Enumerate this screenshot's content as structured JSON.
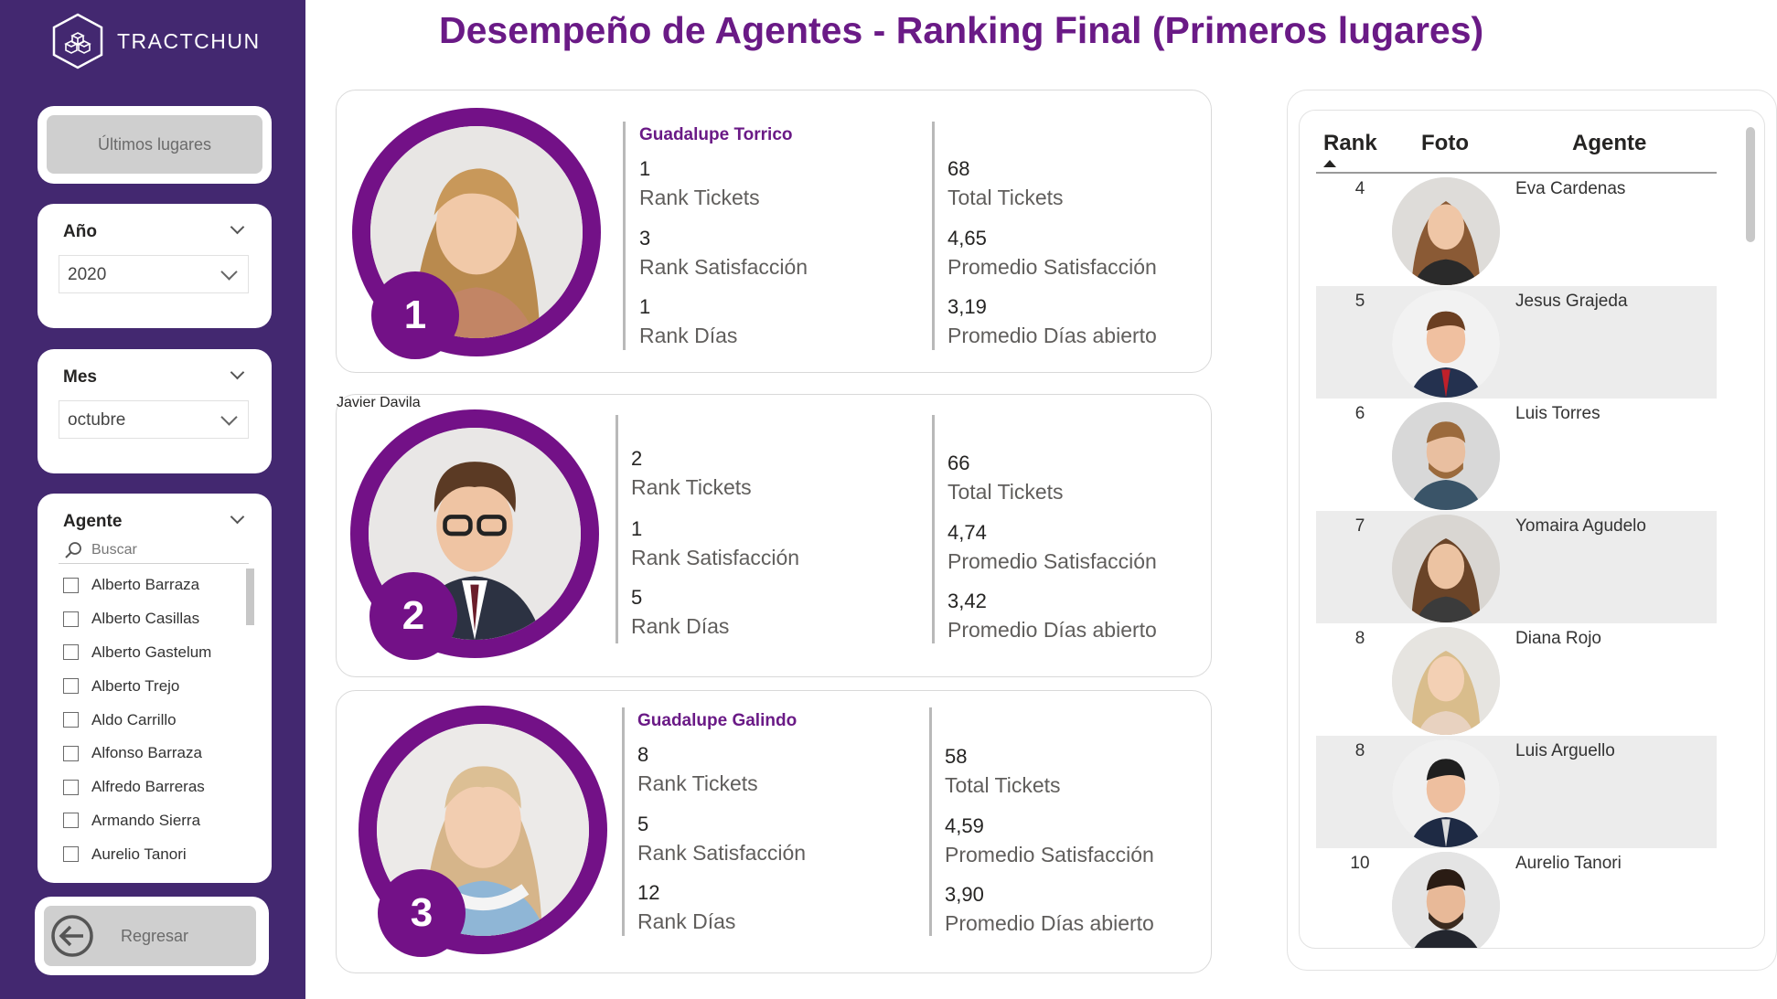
{
  "sidebar": {
    "brand": "TRACTCHUN",
    "last_places_button": "Últimos lugares",
    "year": {
      "title": "Año",
      "value": "2020"
    },
    "month": {
      "title": "Mes",
      "value": "octubre"
    },
    "agent_filter": {
      "title": "Agente",
      "search_placeholder": "Buscar",
      "items": [
        "Alberto Barraza",
        "Alberto Casillas",
        "Alberto Gastelum",
        "Alberto Trejo",
        "Aldo Carrillo",
        "Alfonso Barraza",
        "Alfredo Barreras",
        "Armando Sierra",
        "Aurelio Tanori"
      ]
    },
    "back_button": "Regresar"
  },
  "title": "Desempeño de Agentes - Ranking Final (Primeros lugares)",
  "top": [
    {
      "rank": "1",
      "name": "Guadalupe Torrico",
      "rank_tickets": "1",
      "rank_tickets_label": "Rank Tickets",
      "rank_satisfaction": "3",
      "rank_satisfaction_label": "Rank Satisfacción",
      "rank_days": "1",
      "rank_days_label": "Rank Días",
      "total_tickets": "68",
      "total_tickets_label": "Total Tickets",
      "avg_satisfaction": "4,65",
      "avg_satisfaction_label": "Promedio Satisfacción",
      "avg_days": "3,19",
      "avg_days_label": "Promedio Días abierto"
    },
    {
      "rank": "2",
      "name": "Javier Davila",
      "rank_tickets": "2",
      "rank_tickets_label": "Rank Tickets",
      "rank_satisfaction": "1",
      "rank_satisfaction_label": "Rank Satisfacción",
      "rank_days": "5",
      "rank_days_label": "Rank Días",
      "total_tickets": "66",
      "total_tickets_label": "Total Tickets",
      "avg_satisfaction": "4,74",
      "avg_satisfaction_label": "Promedio Satisfacción",
      "avg_days": "3,42",
      "avg_days_label": "Promedio Días abierto"
    },
    {
      "rank": "3",
      "name": "Guadalupe Galindo",
      "rank_tickets": "8",
      "rank_tickets_label": "Rank Tickets",
      "rank_satisfaction": "5",
      "rank_satisfaction_label": "Rank Satisfacción",
      "rank_days": "12",
      "rank_days_label": "Rank Días",
      "total_tickets": "58",
      "total_tickets_label": "Total Tickets",
      "avg_satisfaction": "4,59",
      "avg_satisfaction_label": "Promedio Satisfacción",
      "avg_days": "3,90",
      "avg_days_label": "Promedio Días abierto"
    }
  ],
  "table": {
    "headers": {
      "rank": "Rank",
      "photo": "Foto",
      "agent": "Agente"
    },
    "rows": [
      {
        "rank": "4",
        "agent": "Eva Cardenas"
      },
      {
        "rank": "5",
        "agent": "Jesus Grajeda"
      },
      {
        "rank": "6",
        "agent": "Luis Torres"
      },
      {
        "rank": "7",
        "agent": "Yomaira Agudelo"
      },
      {
        "rank": "8",
        "agent": "Diana Rojo"
      },
      {
        "rank": "8",
        "agent": "Luis Arguello"
      },
      {
        "rank": "10",
        "agent": "Aurelio Tanori"
      }
    ]
  },
  "colors": {
    "sidebar": "#432870",
    "accent": "#731187",
    "title": "#6a1a86"
  }
}
